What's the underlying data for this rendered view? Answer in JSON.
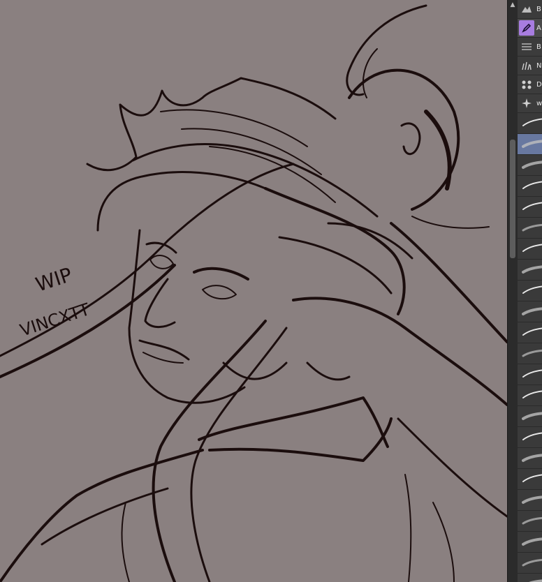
{
  "colors": {
    "canvas_bg": "#8a8080",
    "ink": "#1b0d0d",
    "panel_bg": "#3a3a3a",
    "accent": "#a87de0",
    "selected": "#6878a0"
  },
  "canvas": {
    "annotations": [
      "WIP",
      "VINCXTT"
    ]
  },
  "brush_panel": {
    "tabs": [
      {
        "label": "B",
        "icon": "brush-group-icon",
        "active": false
      },
      {
        "label": "A",
        "icon": "pen-icon",
        "active": true
      },
      {
        "label": "B",
        "icon": "lines-icon",
        "active": false
      },
      {
        "label": "N",
        "icon": "grass-icon",
        "active": false
      },
      {
        "label": "D",
        "icon": "decoration-icon",
        "active": false
      },
      {
        "label": "w",
        "icon": "sparkle-icon",
        "active": false
      }
    ],
    "brushes": [
      {
        "preview": "stroke-thin",
        "selected": false
      },
      {
        "preview": "stroke-soft",
        "selected": true
      },
      {
        "preview": "stroke-soft",
        "selected": false
      },
      {
        "preview": "stroke-thin",
        "selected": false
      },
      {
        "preview": "stroke-thin",
        "selected": false
      },
      {
        "preview": "stroke-dark",
        "selected": false
      },
      {
        "preview": "stroke-thin",
        "selected": false
      },
      {
        "preview": "stroke-soft",
        "selected": false
      },
      {
        "preview": "stroke-thin",
        "selected": false
      },
      {
        "preview": "stroke-soft",
        "selected": false
      },
      {
        "preview": "stroke-thin",
        "selected": false
      },
      {
        "preview": "stroke-dark",
        "selected": false
      },
      {
        "preview": "stroke-thin",
        "selected": false
      },
      {
        "preview": "stroke-thin",
        "selected": false
      },
      {
        "preview": "stroke-soft",
        "selected": false
      },
      {
        "preview": "stroke-thin",
        "selected": false
      },
      {
        "preview": "stroke-soft",
        "selected": false
      },
      {
        "preview": "stroke-thin",
        "selected": false
      },
      {
        "preview": "stroke-soft",
        "selected": false
      },
      {
        "preview": "stroke-dark",
        "selected": false
      },
      {
        "preview": "stroke-soft",
        "selected": false
      },
      {
        "preview": "stroke-dark",
        "selected": false
      },
      {
        "preview": "stroke-soft",
        "selected": false
      }
    ]
  }
}
